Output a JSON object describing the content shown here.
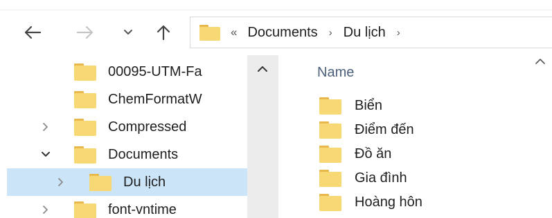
{
  "address_bar": {
    "overflow_chevron": "«",
    "separator": "›",
    "breadcrumbs": [
      "Documents",
      "Du lịch"
    ]
  },
  "navigation": {
    "buttons": [
      "back",
      "forward",
      "recent-locations",
      "up"
    ]
  },
  "nav_tree": {
    "items": [
      {
        "label": "00095-UTM-Fa",
        "expand": "none",
        "selected": false
      },
      {
        "label": "ChemFormatW",
        "expand": "none",
        "selected": false
      },
      {
        "label": "Compressed",
        "expand": "collapsed",
        "selected": false
      },
      {
        "label": "Documents",
        "expand": "expanded",
        "selected": false
      },
      {
        "label": "Du lịch",
        "expand": "collapsed",
        "selected": true
      },
      {
        "label": "font-vntime",
        "expand": "collapsed",
        "selected": false
      }
    ]
  },
  "content": {
    "column_header": "Name",
    "items": [
      {
        "label": "Biển"
      },
      {
        "label": "Điểm đến"
      },
      {
        "label": "Đồ ăn"
      },
      {
        "label": "Gia đình"
      },
      {
        "label": "Hoàng hôn"
      }
    ]
  },
  "colors": {
    "selection": "#cce4f7",
    "folder_fill": "#f8d775",
    "folder_tab": "#e8b94a",
    "scrollbar": "#ececec",
    "header_text": "#4c607a"
  },
  "icons": {
    "folder": "folder-icon",
    "back": "arrow-left-icon",
    "forward": "arrow-right-icon",
    "recent": "chevron-down-icon",
    "up": "arrow-up-icon"
  }
}
